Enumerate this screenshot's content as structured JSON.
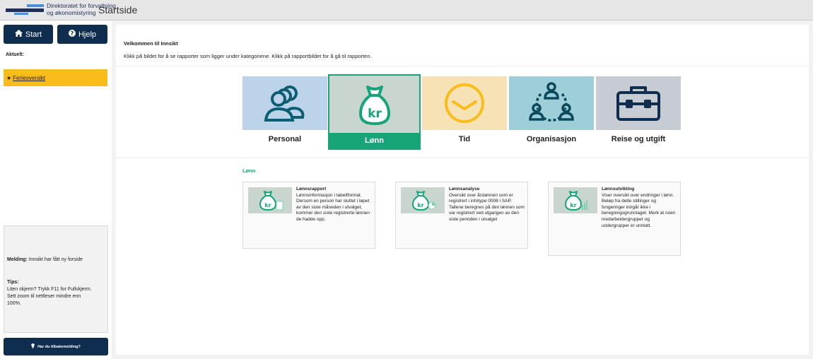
{
  "header": {
    "logo_line1": "Direktoratet for forvaltning",
    "logo_line2": "og økonomistyring",
    "title": "Startside"
  },
  "sidebar": {
    "start_label": "Start",
    "help_label": "Hjelp",
    "aktuelt_label": "Aktuelt:",
    "ferie_label": "Ferieoversikt",
    "melding_label": "Melding:",
    "melding_text": " Innsikt har fått ny forside",
    "tips_label": "Tips:",
    "tips_text": "Liten skjerm? Trykk F11 for Fullskjerm. Sett zoom til nettleser mindre enn 100%.",
    "feedback_label": "Har du tilbakemelding?"
  },
  "main": {
    "welcome": "Velkommen til Innsikt",
    "instructions": "Klikk på bildet for å se rapporter som ligger under kategoriene. Klikk på rapportbildet for å gå til rapporten.",
    "categories": [
      {
        "label": "Personal",
        "bg": "#bdd3ea",
        "icon": "people-icon"
      },
      {
        "label": "Lønn",
        "bg": "#c9d5cf",
        "icon": "money-bag-icon",
        "active": true
      },
      {
        "label": "Tid",
        "bg": "#f6e2b5",
        "icon": "clock-icon"
      },
      {
        "label": "Organisasjon",
        "bg": "#9ecfd9",
        "icon": "org-chart-icon"
      },
      {
        "label": "Reise og utgift",
        "bg": "#c6ccd2",
        "icon": "briefcase-icon"
      }
    ],
    "section_title": "Lønn",
    "reports": [
      {
        "title": "Lønnsrapport",
        "desc": "Lønnsinformasjon i tabellformat. Dersom en person har sluttet i løpet av den siste måneden i utvalget, kommer den siste registrerte lønnen de hadde opp."
      },
      {
        "title": "Lønnsanalyse",
        "desc": "Oversikt over årslønnen som er registrert i infotype 0008 i SAP. Tallene beregnes på den lønnen som var registrert ved utgangen av den siste perioden i utvalget"
      },
      {
        "title": "Lønnsutvikling",
        "desc": "Viser oversikt over endringer i lønn. Beløp fra delte stillinger og fungeringer inngår ikke i beregningsgrunnlaget. Merk at noen medarbeidergrupper og undergrupper er unntatt."
      }
    ]
  },
  "colors": {
    "navy": "#0e2d4f",
    "accent_green": "#17a479",
    "highlight_yellow": "#f9bc1a",
    "icon_stroke": "#0b5e73"
  }
}
